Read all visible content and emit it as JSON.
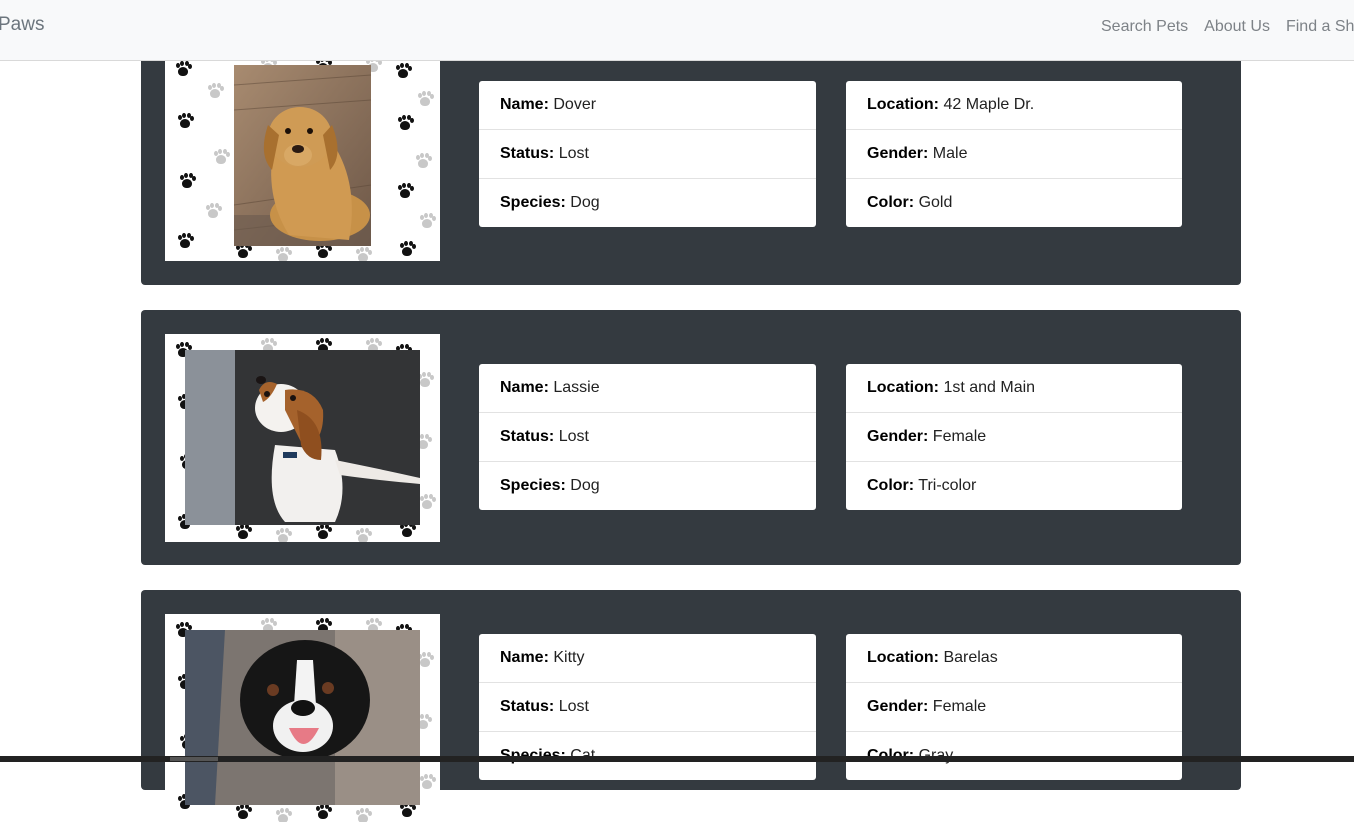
{
  "navbar": {
    "brand": "Paws",
    "links": [
      "Search Pets",
      "About Us",
      "Find a Shel"
    ]
  },
  "pets": [
    {
      "name_label": "Name:",
      "name": "Dover",
      "status_label": "Status:",
      "status": "Lost",
      "species_label": "Species:",
      "species": "Dog",
      "location_label": "Location:",
      "location": "42 Maple Dr.",
      "gender_label": "Gender:",
      "gender": "Male",
      "color_label": "Color:",
      "color": "Gold",
      "photo_subject": "golden labrador"
    },
    {
      "name_label": "Name:",
      "name": "Lassie",
      "status_label": "Status:",
      "status": "Lost",
      "species_label": "Species:",
      "species": "Dog",
      "location_label": "Location:",
      "location": "1st and Main",
      "gender_label": "Gender:",
      "gender": "Female",
      "color_label": "Color:",
      "color": "Tri-color",
      "photo_subject": "beagle puppy"
    },
    {
      "name_label": "Name:",
      "name": "Kitty",
      "status_label": "Status:",
      "status": "Lost",
      "species_label": "Species:",
      "species": "Cat",
      "location_label": "Location:",
      "location": "Barelas",
      "gender_label": "Gender:",
      "gender": "Female",
      "color_label": "Color:",
      "color": "Gray",
      "photo_subject": "black and white dog"
    }
  ],
  "colors": {
    "card_bg": "#343a40",
    "navbar_bg": "#f8f9fa",
    "nav_link": "#7d8287"
  }
}
